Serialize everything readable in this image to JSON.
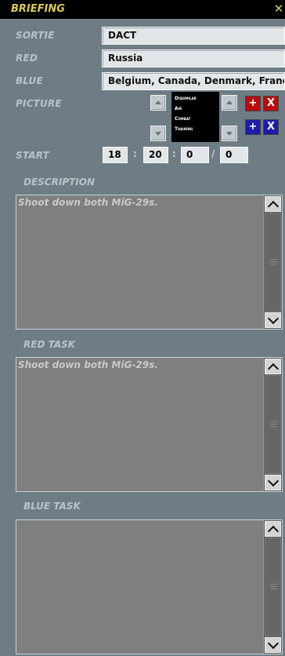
{
  "window": {
    "title": "BRIEFING",
    "close_label": "✕"
  },
  "form": {
    "sortie": {
      "label": "SORTIE",
      "value": "DACT"
    },
    "red": {
      "label": "RED",
      "value": "Russia"
    },
    "blue": {
      "label": "BLUE",
      "value": "Belgium, Canada, Denmark, France, Germany"
    },
    "picture": {
      "label": "PICTURE",
      "image_lines": [
        "Dissimilar",
        "Air",
        "Combat",
        "Training"
      ],
      "add_label": "+",
      "remove_label": "X"
    },
    "start": {
      "label": "START",
      "hour": "18",
      "minute": "20",
      "second": "0",
      "day": "0",
      "sep_colon": ":",
      "sep_slash": "/"
    }
  },
  "sections": {
    "description": {
      "label": "DESCRIPTION",
      "text": "Shoot down both MiG-29s."
    },
    "red_task": {
      "label": "RED TASK",
      "text": "Shoot down both MiG-29s."
    },
    "blue_task": {
      "label": "BLUE TASK",
      "text": ""
    }
  },
  "colors": {
    "title": "#d8cc55",
    "background": "#6e7d85",
    "red_button": "#b80c0c",
    "blue_button": "#1c1ca8"
  }
}
